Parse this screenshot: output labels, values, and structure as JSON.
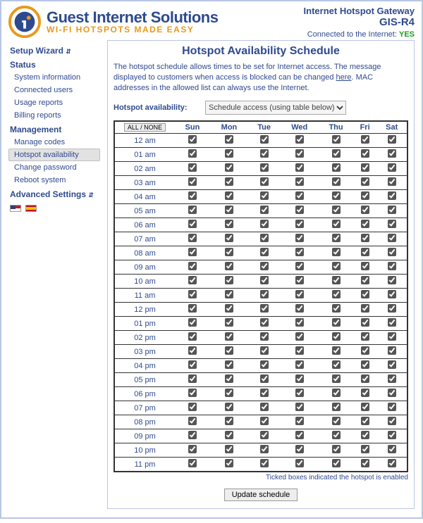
{
  "brand": {
    "title": "Guest Internet Solutions",
    "subtitle": "WI-FI HOTSPOTS MADE EASY"
  },
  "header_right": {
    "line1": "Internet Hotspot Gateway",
    "line2": "GIS-R4",
    "connected_prefix": "Connected to the Internet: ",
    "connected_status": "YES"
  },
  "sidebar": {
    "setup_wizard": "Setup Wizard",
    "status": "Status",
    "system_information": "System information",
    "connected_users": "Connected users",
    "usage_reports": "Usage reports",
    "billing_reports": "Billing reports",
    "management": "Management",
    "manage_codes": "Manage codes",
    "hotspot_availability": "Hotspot availability",
    "change_password": "Change password",
    "reboot_system": "Reboot system",
    "advanced_settings": "Advanced Settings"
  },
  "page": {
    "title": "Hotspot Availability Schedule",
    "intro_pre": "The hotspot schedule allows times to be set for Internet access. The message displayed to customers when access is blocked can be changed ",
    "intro_link": "here",
    "intro_post": ". MAC addresses in the allowed list can always use the Internet.",
    "avail_label": "Hotspot availability:",
    "select_value": "Schedule access (using table below)",
    "all_none": "ALL / NONE",
    "days": [
      "Sun",
      "Mon",
      "Tue",
      "Wed",
      "Thu",
      "Fri",
      "Sat"
    ],
    "hours": [
      "12 am",
      "01 am",
      "02 am",
      "03 am",
      "04 am",
      "05 am",
      "06 am",
      "07 am",
      "08 am",
      "09 am",
      "10 am",
      "11 am",
      "12 pm",
      "01 pm",
      "02 pm",
      "03 pm",
      "04 pm",
      "05 pm",
      "06 pm",
      "07 pm",
      "08 pm",
      "09 pm",
      "10 pm",
      "11 pm"
    ],
    "footnote": "Ticked boxes indicated the hotspot is enabled",
    "update_btn": "Update schedule"
  },
  "glyph": {
    "chev": "⇵"
  }
}
